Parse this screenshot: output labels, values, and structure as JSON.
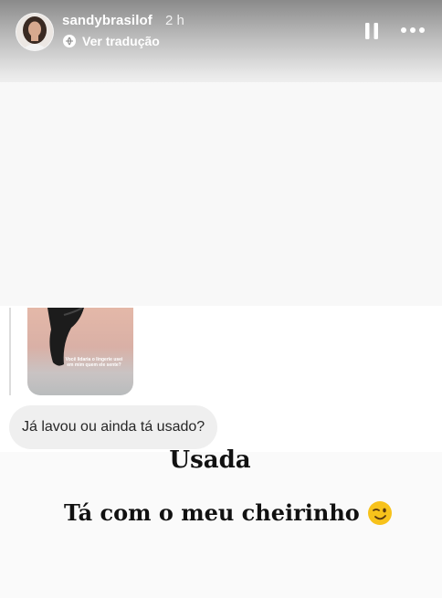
{
  "header": {
    "username": "sandybrasilof",
    "time": "2 h",
    "translate_label": "Ver tradução"
  },
  "dm": {
    "thumb_caption": "Você lidaria o lingerie usei em mim quem ele sente?",
    "message": "Já lavou ou ainda tá usado?"
  },
  "captions": {
    "line1": "Usada",
    "line2": "Tá com o meu cheirinho"
  },
  "icons": {
    "pause": "pause-icon",
    "more": "more-icon",
    "translate": "translate-icon",
    "emoji": "wink-emoji-icon"
  },
  "colors": {
    "bubble_bg": "#efefef",
    "caption_text": "#111111"
  }
}
